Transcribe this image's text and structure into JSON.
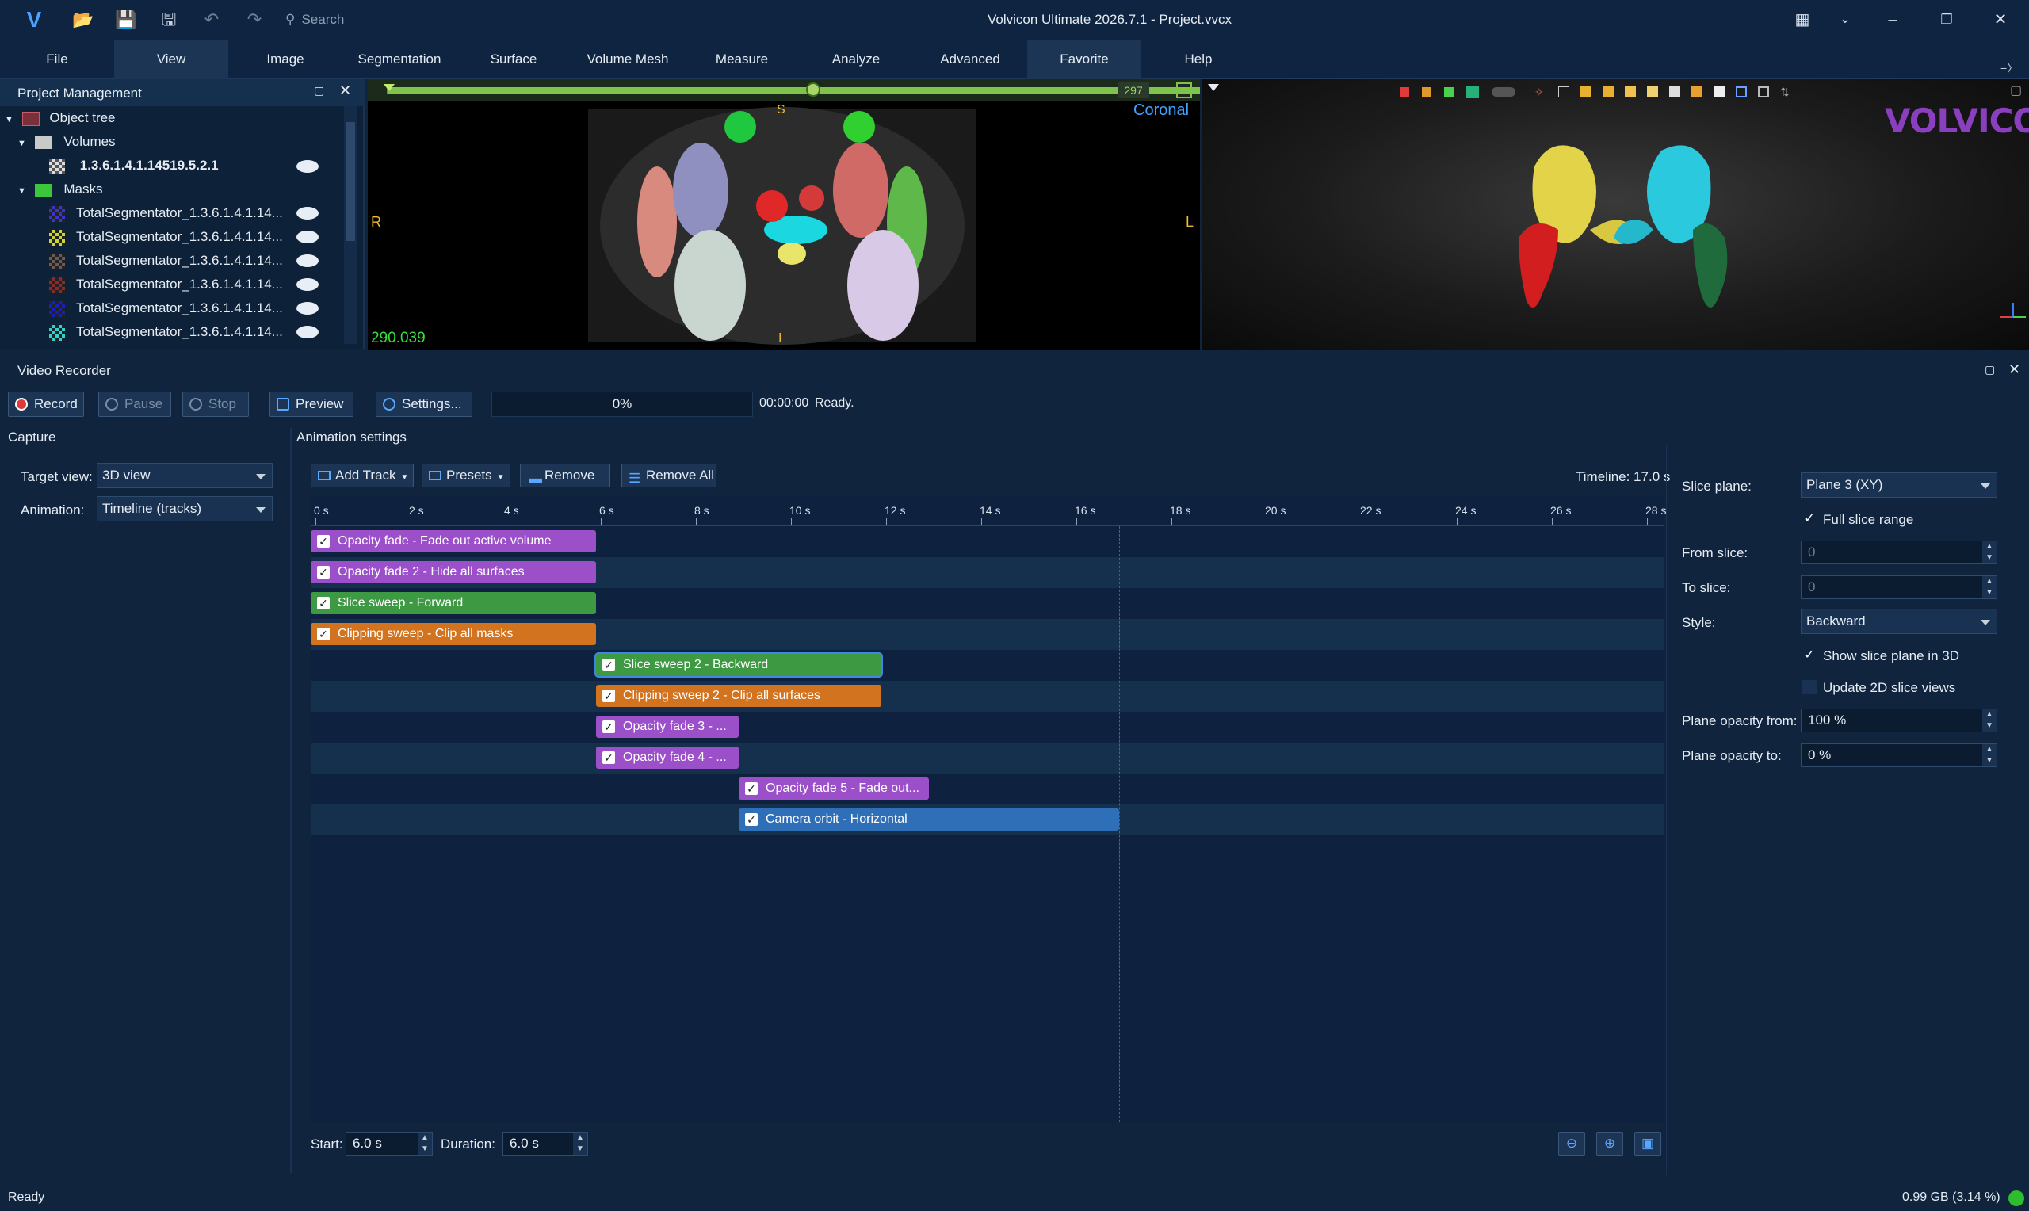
{
  "app": {
    "title": "Volvicon Ultimate 2026.7.1 - Project.vvcx",
    "search_placeholder": "Search"
  },
  "menu": [
    "File",
    "View",
    "Image",
    "Segmentation",
    "Surface",
    "Volume Mesh",
    "Measure",
    "Analyze",
    "Advanced",
    "Favorite",
    "Help"
  ],
  "project": {
    "title": "Project Management",
    "tree": {
      "root": "Object tree",
      "volumes_label": "Volumes",
      "volume_item": "1.3.6.1.4.1.14519.5.2.1",
      "masks_label": "Masks",
      "masks": [
        {
          "label": "TotalSegmentator_1.3.6.1.4.1.14...",
          "color": "#3a36c8"
        },
        {
          "label": "TotalSegmentator_1.3.6.1.4.1.14...",
          "color": "#c9d43a"
        },
        {
          "label": "TotalSegmentator_1.3.6.1.4.1.14...",
          "color": "#6b5a5a"
        },
        {
          "label": "TotalSegmentator_1.3.6.1.4.1.14...",
          "color": "#8a2a2a"
        },
        {
          "label": "TotalSegmentator_1.3.6.1.4.1.14...",
          "color": "#1420c0"
        },
        {
          "label": "TotalSegmentator_1.3.6.1.4.1.14...",
          "color": "#2ed1d1"
        }
      ]
    }
  },
  "view2d": {
    "slice_value": "297",
    "orientation": "Coronal",
    "left_marker": "R",
    "right_marker": "L",
    "top_marker": "S",
    "bottom_marker": "I",
    "window_value": "290.039",
    "slider_fraction": 0.58
  },
  "view3d": {
    "logo": "VOLVICON"
  },
  "recorder": {
    "title": "Video Recorder",
    "buttons": {
      "record": "Record",
      "pause": "Pause",
      "stop": "Stop",
      "preview": "Preview",
      "settings": "Settings..."
    },
    "progress": "0%",
    "time": "00:00:00",
    "status": "Ready."
  },
  "capture": {
    "title": "Capture",
    "target_view_label": "Target view:",
    "target_view_value": "3D view",
    "animation_label": "Animation:",
    "animation_value": "Timeline (tracks)"
  },
  "animation": {
    "title": "Animation settings",
    "add_track": "Add Track",
    "presets": "Presets",
    "remove": "Remove",
    "remove_all": "Remove All",
    "timeline_label": "Timeline: 17.0 s",
    "ticks": [
      "0 s",
      "2 s",
      "4 s",
      "6 s",
      "8 s",
      "10 s",
      "12 s",
      "14 s",
      "16 s",
      "18 s",
      "20 s",
      "22 s",
      "24 s",
      "26 s",
      "28 s"
    ],
    "playhead_seconds": 17.0,
    "tracks": [
      {
        "label": "Opacity fade - Fade out active volume",
        "start": 0,
        "duration": 6,
        "color": "#9b4fc9"
      },
      {
        "label": "Opacity fade 2 - Hide all surfaces",
        "start": 0,
        "duration": 6,
        "color": "#9b4fc9"
      },
      {
        "label": "Slice sweep - Forward",
        "start": 0,
        "duration": 6,
        "color": "#3e9a42"
      },
      {
        "label": "Clipping sweep - Clip all masks",
        "start": 0,
        "duration": 6,
        "color": "#d2731f"
      },
      {
        "label": "Slice sweep 2 - Backward",
        "start": 6,
        "duration": 6,
        "color": "#3e9a42"
      },
      {
        "label": "Clipping sweep 2 - Clip all surfaces",
        "start": 6,
        "duration": 6,
        "color": "#d2731f"
      },
      {
        "label": "Opacity fade 3 - ...",
        "start": 6,
        "duration": 3,
        "color": "#9b4fc9"
      },
      {
        "label": "Opacity fade 4 - ...",
        "start": 6,
        "duration": 3,
        "color": "#9b4fc9"
      },
      {
        "label": "Opacity fade 5 - Fade out...",
        "start": 9,
        "duration": 4,
        "color": "#9b4fc9"
      },
      {
        "label": "Camera orbit - Horizontal",
        "start": 9,
        "duration": 8,
        "color": "#2f6fb8"
      }
    ],
    "start_label": "Start:",
    "start_value": "6.0 s",
    "duration_label": "Duration:",
    "duration_value": "6.0 s"
  },
  "properties": {
    "slice_plane_label": "Slice plane:",
    "slice_plane_value": "Plane 3 (XY)",
    "full_slice_range": "Full slice range",
    "from_slice_label": "From slice:",
    "from_slice_value": "0",
    "to_slice_label": "To slice:",
    "to_slice_value": "0",
    "style_label": "Style:",
    "style_value": "Backward",
    "show_slice_plane": "Show slice plane in 3D",
    "update_2d": "Update 2D slice views",
    "opacity_from_label": "Plane opacity from:",
    "opacity_from_value": "100 %",
    "opacity_to_label": "Plane opacity to:",
    "opacity_to_value": "0 %"
  },
  "statusbar": {
    "left": "Ready",
    "memory": "0.99 GB (3.14 %)"
  }
}
